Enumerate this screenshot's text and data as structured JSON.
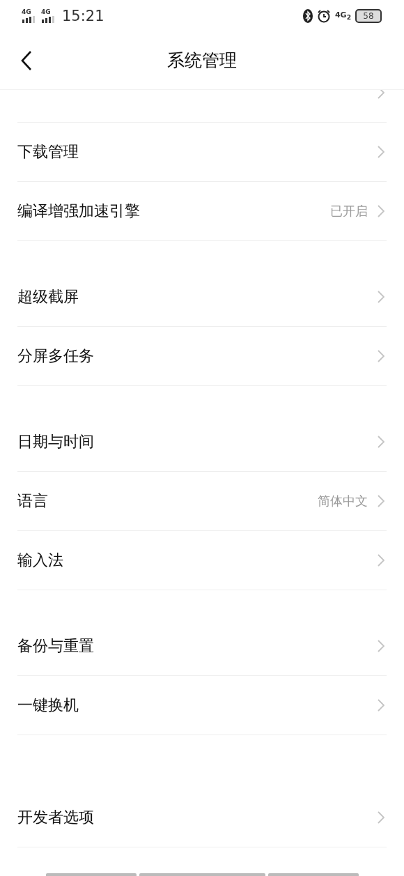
{
  "status_bar": {
    "sim_1": "4G",
    "sim_2": "4G",
    "time": "15:21",
    "network": "4G$_{2}$",
    "battery": "58"
  },
  "header": {
    "title": "系统管理"
  },
  "groups": [
    {
      "cut_row_above": true,
      "items": [
        {
          "label": "下载管理"
        },
        {
          "label": "编译增强加速引擎",
          "value": "已开启"
        }
      ]
    },
    {
      "items": [
        {
          "label": "超级截屏"
        },
        {
          "label": "分屏多任务"
        }
      ]
    },
    {
      "items": [
        {
          "label": "日期与时间"
        },
        {
          "label": "语言",
          "value": "简体中文"
        },
        {
          "label": "输入法"
        }
      ]
    },
    {
      "items": [
        {
          "label": "备份与重置"
        },
        {
          "label": "一键换机"
        }
      ]
    },
    {
      "items": [
        {
          "label": "开发者选项"
        }
      ]
    }
  ]
}
